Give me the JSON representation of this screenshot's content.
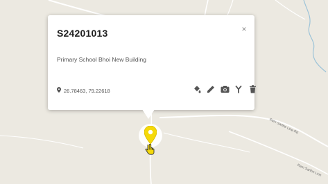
{
  "map": {
    "road_label_1": "Ram Sarthe Line Rd",
    "road_label_2": "Ram Sarthe Line"
  },
  "popup": {
    "title": "S24201013",
    "description": "Primary School Bhoi New Building",
    "coordinates": "26.78463, 79.22618",
    "close_label": "×",
    "tools": [
      "paint-bucket-icon",
      "pencil-icon",
      "camera-icon",
      "fork-icon",
      "trash-icon"
    ]
  },
  "marker": {
    "color": "#f5d90a",
    "halo_color": "#ffffff"
  }
}
